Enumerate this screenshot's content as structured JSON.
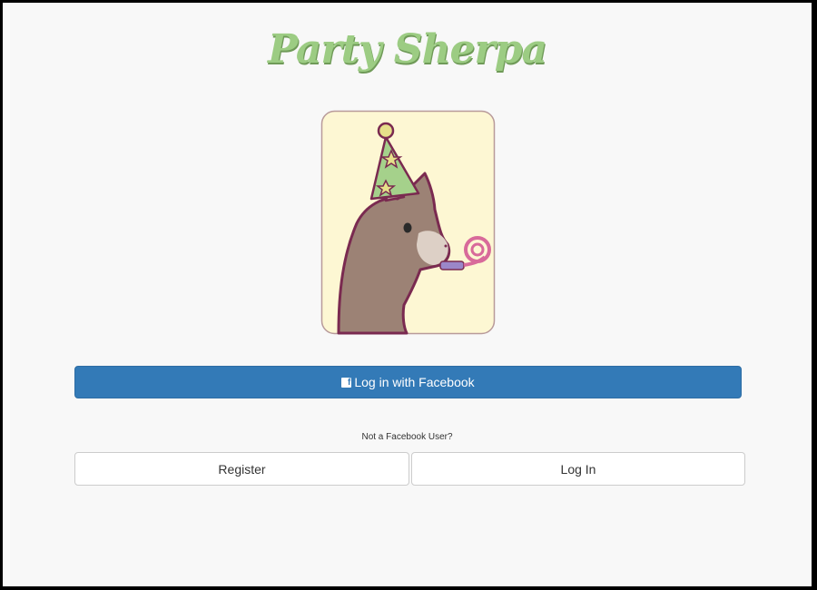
{
  "app": {
    "logo_text": "Party Sherpa"
  },
  "mascot": {
    "icon": "party-llama-icon"
  },
  "auth": {
    "facebook_icon": "facebook-icon",
    "facebook_glyph": "f",
    "facebook_label": "Log in with Facebook",
    "alt_prompt": "Not a Facebook User?",
    "register_label": "Register",
    "login_label": "Log In"
  },
  "colors": {
    "background": "#f8f8f8",
    "facebook_blue": "#337ab7",
    "logo_green": "#9ccc83"
  }
}
